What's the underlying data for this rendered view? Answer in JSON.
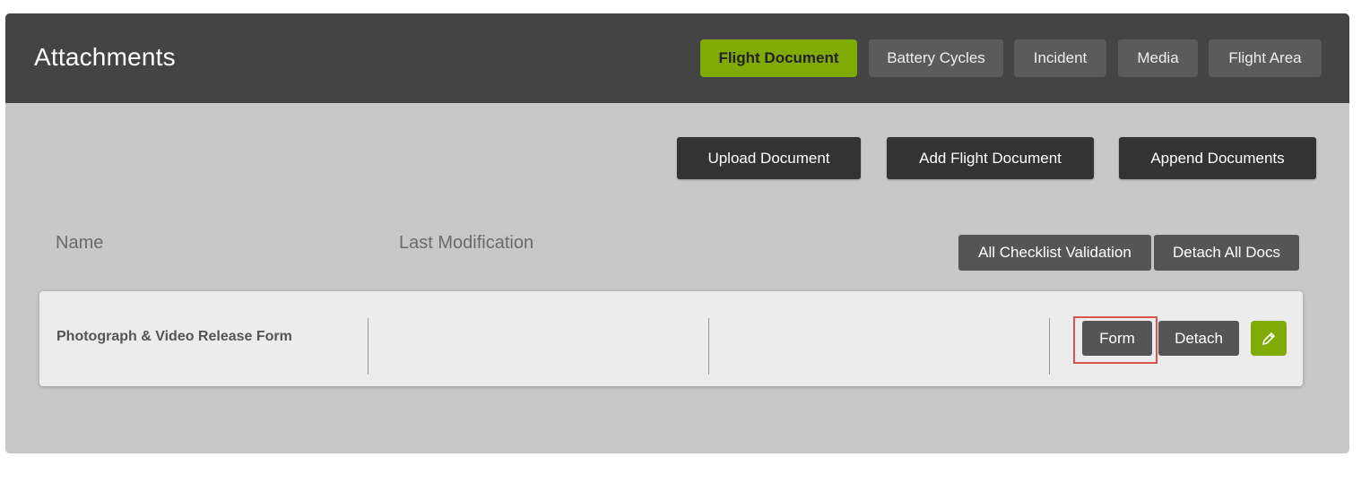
{
  "panel": {
    "title": "Attachments"
  },
  "tabs": [
    {
      "label": "Flight Document",
      "active": true
    },
    {
      "label": "Battery Cycles",
      "active": false
    },
    {
      "label": "Incident",
      "active": false
    },
    {
      "label": "Media",
      "active": false
    },
    {
      "label": "Flight Area",
      "active": false
    }
  ],
  "actions": {
    "upload_label": "Upload Document",
    "add_label": "Add Flight Document",
    "append_label": "Append Documents"
  },
  "table": {
    "columns": [
      "Name",
      "Last Modification"
    ],
    "all_checklist_label": "All Checklist Validation",
    "detach_all_label": "Detach All Docs",
    "rows": [
      {
        "name": "Photograph & Video Release Form",
        "form_label": "Form",
        "detach_label": "Detach",
        "edit_icon": "pencil-icon"
      }
    ]
  },
  "colors": {
    "accent": "#7fab04",
    "header_bg": "#444444",
    "panel_bg": "#c8c8c8",
    "highlight": "#d9534f"
  }
}
